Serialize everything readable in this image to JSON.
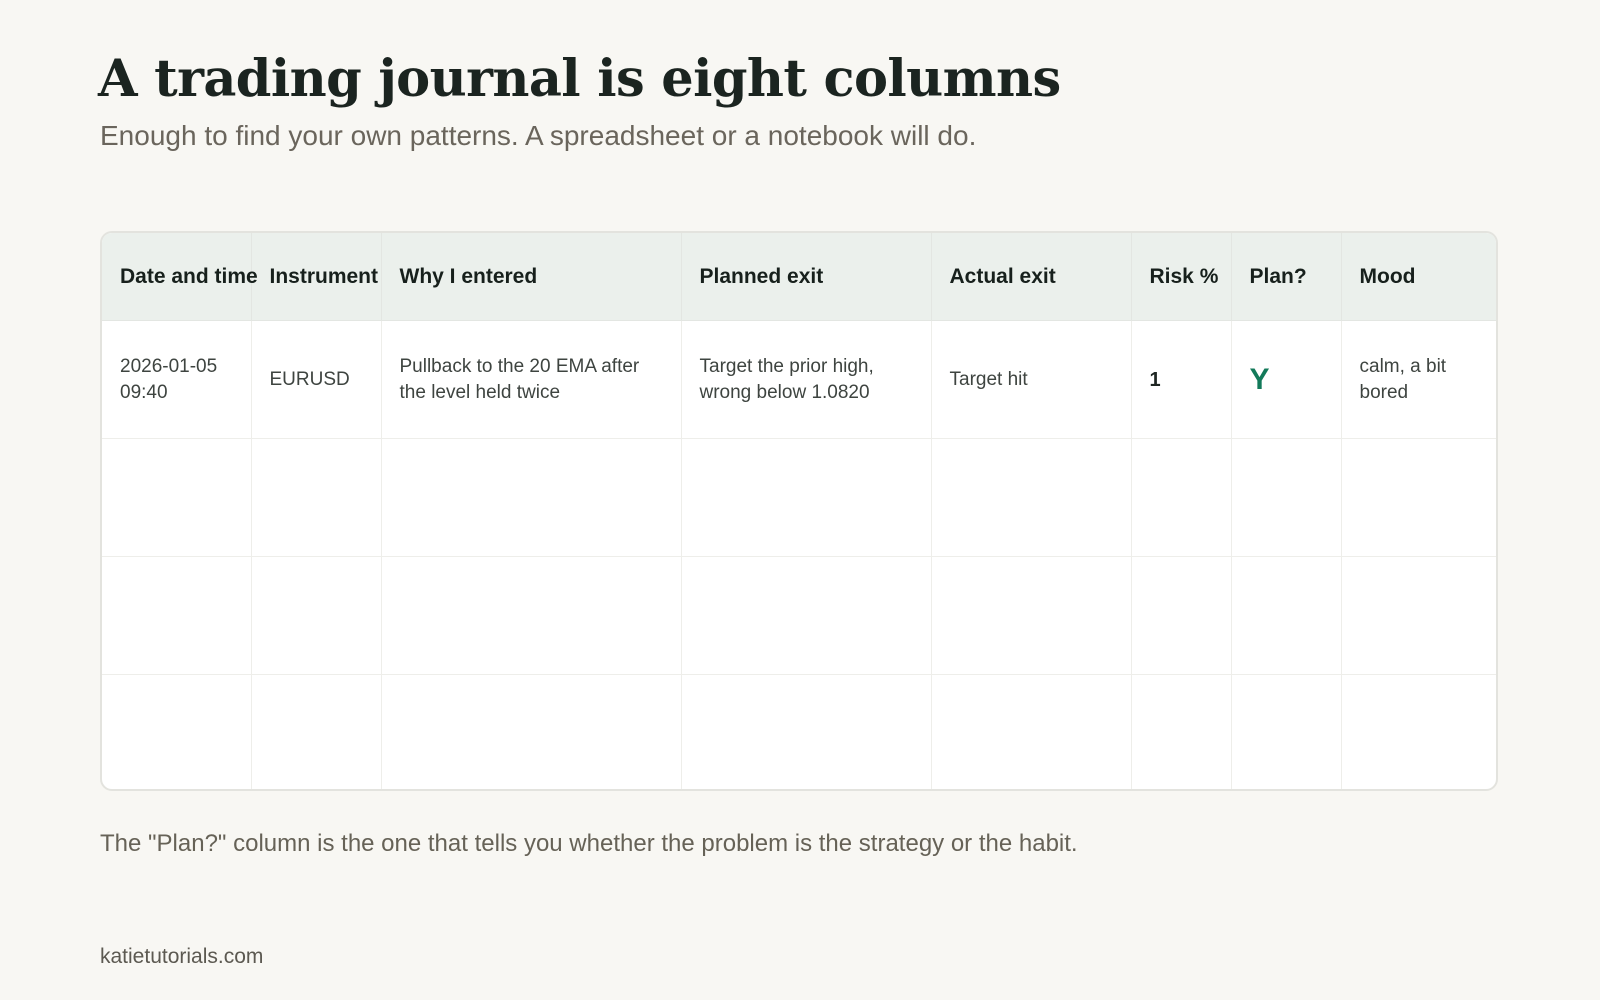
{
  "header": {
    "title": "A trading journal is eight columns",
    "subtitle": "Enough to find your own patterns. A spreadsheet or a notebook will do."
  },
  "journal_table": {
    "columns": [
      "Date and time",
      "Instrument",
      "Why I entered",
      "Planned exit",
      "Actual exit",
      "Risk %",
      "Plan?",
      "Mood"
    ],
    "rows": [
      [
        "2026-01-05 09:40",
        "EURUSD",
        "Pullback to the 20 EMA after the level held twice",
        "Target the prior high, wrong below 1.0820",
        "Target hit",
        "1",
        "Y",
        "calm, a bit bored"
      ],
      [
        "",
        "",
        "",
        "",
        "",
        "",
        "",
        ""
      ],
      [
        "",
        "",
        "",
        "",
        "",
        "",
        "",
        ""
      ],
      [
        "",
        "",
        "",
        "",
        "",
        "",
        "",
        ""
      ]
    ]
  },
  "note": "The \"Plan?\" column is the one that tells you whether the problem is the strategy or the habit.",
  "footer": {
    "site": "katietutorials.com"
  },
  "colors": {
    "background": "#f8f7f3",
    "header_fill": "#ebf0ec",
    "plan_yes": "#137a5a"
  }
}
